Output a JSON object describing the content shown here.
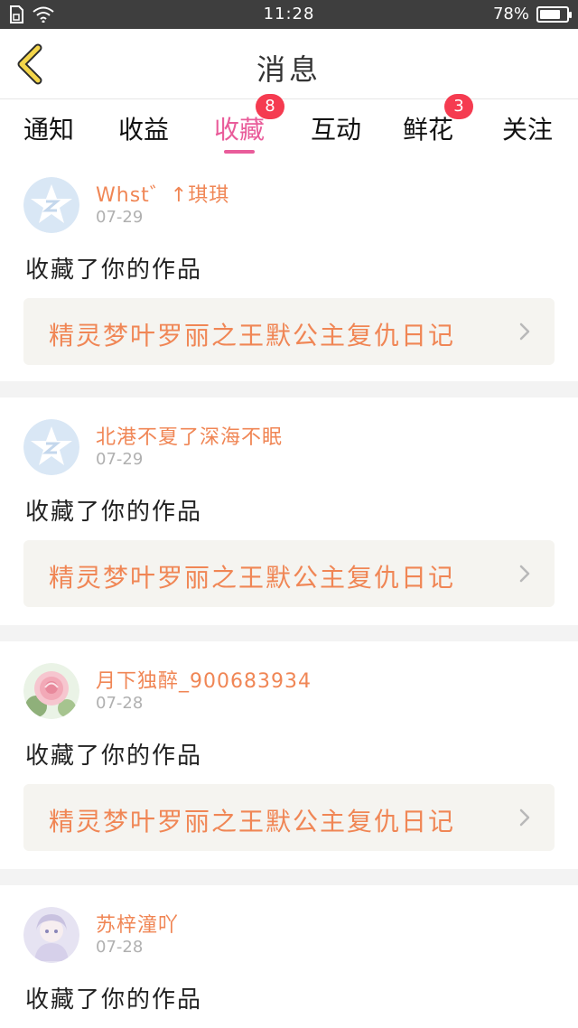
{
  "status_bar": {
    "time": "11:28",
    "battery_percent": "78%",
    "battery_level": 0.78
  },
  "header": {
    "title": "消息"
  },
  "tabs": [
    {
      "label": "通知",
      "badge": ""
    },
    {
      "label": "收益",
      "badge": ""
    },
    {
      "label": "收藏",
      "badge": "8",
      "active": true
    },
    {
      "label": "互动",
      "badge": ""
    },
    {
      "label": "鲜花",
      "badge": "3"
    },
    {
      "label": "关注",
      "badge": ""
    }
  ],
  "feed": [
    {
      "name": "Whst゛↑琪琪",
      "date": "07-29",
      "action": "收藏了你的作品",
      "work_title": "精灵梦叶罗丽之王默公主复仇日记",
      "avatar": "default-avatar-icon"
    },
    {
      "name": "北港不夏了深海不眠",
      "date": "07-29",
      "action": "收藏了你的作品",
      "work_title": "精灵梦叶罗丽之王默公主复仇日记",
      "avatar": "default-avatar-icon"
    },
    {
      "name": "月下独醉_900683934",
      "date": "07-28",
      "action": "收藏了你的作品",
      "work_title": "精灵梦叶罗丽之王默公主复仇日记",
      "avatar": "rose-avatar"
    },
    {
      "name": "苏梓潼吖",
      "date": "07-28",
      "action": "收藏了你的作品",
      "work_title": "",
      "avatar": "anime-avatar"
    }
  ],
  "colors": {
    "accent_pink": "#e95c9a",
    "badge_red": "#f53b50",
    "orange_text": "#f08655",
    "status_bar_bg": "#3e3e3e",
    "back_arrow": "#f4d64a"
  }
}
